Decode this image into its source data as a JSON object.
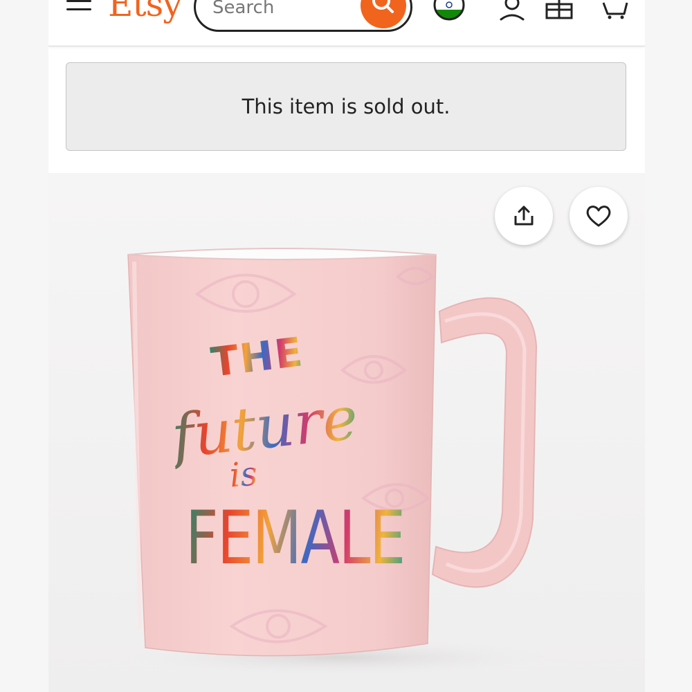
{
  "header": {
    "logo": "Etsy",
    "search": {
      "placeholder": "Search"
    },
    "icons": [
      "menu-icon",
      "search-icon",
      "india-flag-icon",
      "account-icon",
      "gift-icon",
      "cart-icon"
    ]
  },
  "notice": {
    "text": "This item is sold out."
  },
  "listing": {
    "image_icons": [
      "share-icon",
      "heart-icon"
    ],
    "mug_print": {
      "line1": "THE",
      "line2": "future",
      "line3": "is",
      "line4": "FEMALE"
    }
  },
  "colors": {
    "accent": "#f1641e",
    "mug_pink": "#f7cfcf",
    "notice_bg": "#ececec"
  }
}
